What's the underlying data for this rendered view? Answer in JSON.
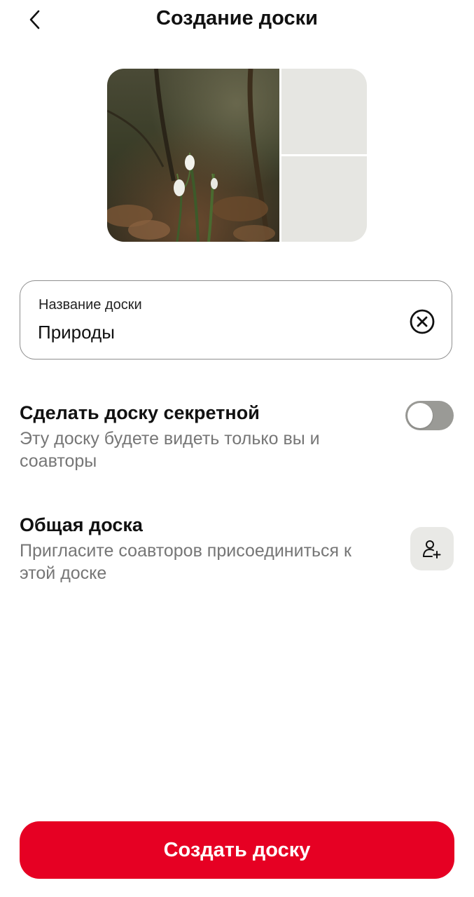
{
  "header": {
    "title": "Создание доски",
    "back_icon": "chevron-left-icon"
  },
  "cover": {
    "main_image": "snowdrop-flowers-photo",
    "placeholder_color": "#e6e6e2"
  },
  "name_field": {
    "label": "Название доски",
    "value": "Природы",
    "clear_icon": "clear-circle-x-icon"
  },
  "secret": {
    "title": "Сделать доску секретной",
    "description": "Эту доску будете видеть только вы и соавторы",
    "toggle_on": false
  },
  "shared": {
    "title": "Общая доска",
    "description": "Пригласите соавторов присоединиться к этой доске",
    "invite_icon": "add-person-icon"
  },
  "create_button": {
    "label": "Создать доску",
    "color": "#e60023"
  }
}
